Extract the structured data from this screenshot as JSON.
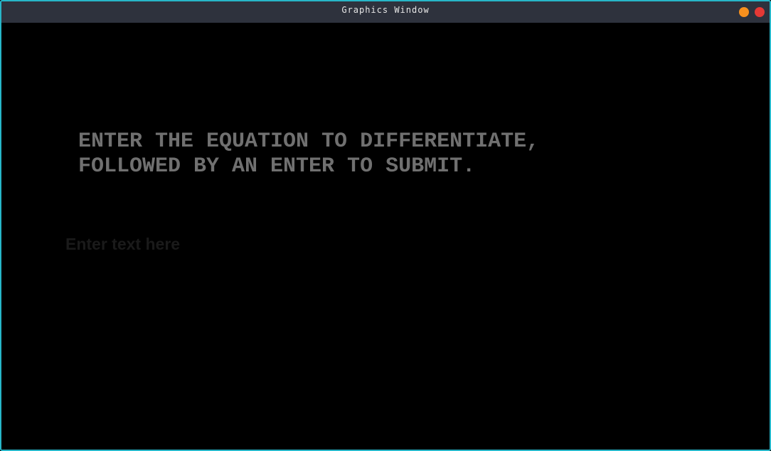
{
  "window": {
    "title": "Graphics Window",
    "buttons": {
      "minimize_color": "#f7901e",
      "close_color": "#e53935"
    },
    "border_color": "#27b6c8"
  },
  "canvas": {
    "prompt_line1": "ENTER THE EQUATION TO DIFFERENTIATE,",
    "prompt_line2": "FOLLOWED BY AN ENTER TO SUBMIT.",
    "input": {
      "value": "",
      "placeholder": "Enter text here"
    }
  }
}
